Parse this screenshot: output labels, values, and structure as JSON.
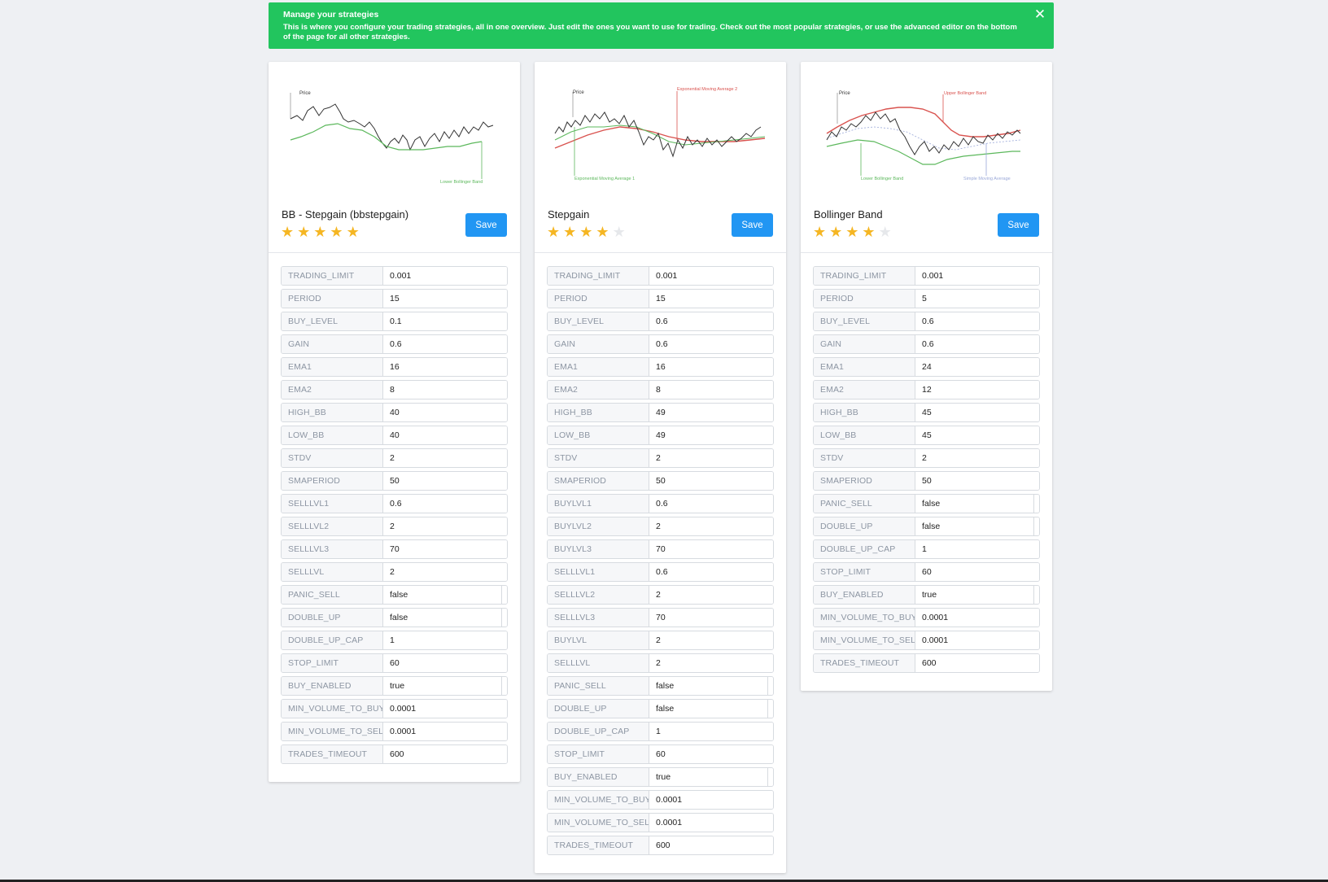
{
  "alert": {
    "title": "Manage your strategies",
    "text": "This is where you configure your trading strategies, all in one overview. Just edit the ones you want to use for trading. Check out the most popular strategies, or use the advanced editor on the bottom of the page for all other strategies.",
    "close_icon": "close-icon",
    "color": "#22c55e"
  },
  "colors": {
    "accent": "#2196f3",
    "toggle_on": "#22c55e",
    "toggle_off": "#f44336",
    "star": "#f5b623"
  },
  "cards": [
    {
      "title": "BB - Stepgain (bbstepgain)",
      "rating": 5,
      "save_label": "Save",
      "chart": {
        "price_label": "Price",
        "annotations": [
          "Lower Bollinger Band"
        ]
      },
      "params": [
        {
          "key": "TRADING_LIMIT",
          "value": "0.001"
        },
        {
          "key": "PERIOD",
          "value": "15"
        },
        {
          "key": "BUY_LEVEL",
          "value": "0.1"
        },
        {
          "key": "GAIN",
          "value": "0.6"
        },
        {
          "key": "EMA1",
          "value": "16"
        },
        {
          "key": "EMA2",
          "value": "8"
        },
        {
          "key": "HIGH_BB",
          "value": "40"
        },
        {
          "key": "LOW_BB",
          "value": "40"
        },
        {
          "key": "STDV",
          "value": "2"
        },
        {
          "key": "SMAPERIOD",
          "value": "50"
        },
        {
          "key": "SELLLVL1",
          "value": "0.6"
        },
        {
          "key": "SELLLVL2",
          "value": "2"
        },
        {
          "key": "SELLLVL3",
          "value": "70"
        },
        {
          "key": "SELLLVL",
          "value": "2"
        },
        {
          "key": "PANIC_SELL",
          "value": "false",
          "toggle": "OFF"
        },
        {
          "key": "DOUBLE_UP",
          "value": "false",
          "toggle": "OFF"
        },
        {
          "key": "DOUBLE_UP_CAP",
          "value": "1"
        },
        {
          "key": "STOP_LIMIT",
          "value": "60"
        },
        {
          "key": "BUY_ENABLED",
          "value": "true",
          "toggle": "ON"
        },
        {
          "key": "MIN_VOLUME_TO_BUY",
          "value": "0.0001"
        },
        {
          "key": "MIN_VOLUME_TO_SELL",
          "value": "0.0001"
        },
        {
          "key": "TRADES_TIMEOUT",
          "value": "600"
        }
      ]
    },
    {
      "title": "Stepgain",
      "rating": 4,
      "save_label": "Save",
      "chart": {
        "price_label": "Price",
        "annotations": [
          "Exponential Moving Average 2",
          "Exponential Moving Average 1"
        ]
      },
      "params": [
        {
          "key": "TRADING_LIMIT",
          "value": "0.001"
        },
        {
          "key": "PERIOD",
          "value": "15"
        },
        {
          "key": "BUY_LEVEL",
          "value": "0.6"
        },
        {
          "key": "GAIN",
          "value": "0.6"
        },
        {
          "key": "EMA1",
          "value": "16"
        },
        {
          "key": "EMA2",
          "value": "8"
        },
        {
          "key": "HIGH_BB",
          "value": "49"
        },
        {
          "key": "LOW_BB",
          "value": "49"
        },
        {
          "key": "STDV",
          "value": "2"
        },
        {
          "key": "SMAPERIOD",
          "value": "50"
        },
        {
          "key": "BUYLVL1",
          "value": "0.6"
        },
        {
          "key": "BUYLVL2",
          "value": "2"
        },
        {
          "key": "BUYLVL3",
          "value": "70"
        },
        {
          "key": "SELLLVL1",
          "value": "0.6"
        },
        {
          "key": "SELLLVL2",
          "value": "2"
        },
        {
          "key": "SELLLVL3",
          "value": "70"
        },
        {
          "key": "BUYLVL",
          "value": "2"
        },
        {
          "key": "SELLLVL",
          "value": "2"
        },
        {
          "key": "PANIC_SELL",
          "value": "false",
          "toggle": "OFF"
        },
        {
          "key": "DOUBLE_UP",
          "value": "false",
          "toggle": "OFF"
        },
        {
          "key": "DOUBLE_UP_CAP",
          "value": "1"
        },
        {
          "key": "STOP_LIMIT",
          "value": "60"
        },
        {
          "key": "BUY_ENABLED",
          "value": "true",
          "toggle": "ON"
        },
        {
          "key": "MIN_VOLUME_TO_BUY",
          "value": "0.0001"
        },
        {
          "key": "MIN_VOLUME_TO_SELL",
          "value": "0.0001"
        },
        {
          "key": "TRADES_TIMEOUT",
          "value": "600"
        }
      ]
    },
    {
      "title": "Bollinger Band",
      "rating": 4,
      "save_label": "Save",
      "chart": {
        "price_label": "Price",
        "annotations": [
          "Upper Bollinger Band",
          "Lower Bollinger Band",
          "Simple Moving Average"
        ]
      },
      "params": [
        {
          "key": "TRADING_LIMIT",
          "value": "0.001"
        },
        {
          "key": "PERIOD",
          "value": "5"
        },
        {
          "key": "BUY_LEVEL",
          "value": "0.6"
        },
        {
          "key": "GAIN",
          "value": "0.6"
        },
        {
          "key": "EMA1",
          "value": "24"
        },
        {
          "key": "EMA2",
          "value": "12"
        },
        {
          "key": "HIGH_BB",
          "value": "45"
        },
        {
          "key": "LOW_BB",
          "value": "45"
        },
        {
          "key": "STDV",
          "value": "2"
        },
        {
          "key": "SMAPERIOD",
          "value": "50"
        },
        {
          "key": "PANIC_SELL",
          "value": "false",
          "toggle": "OFF"
        },
        {
          "key": "DOUBLE_UP",
          "value": "false",
          "toggle": "OFF"
        },
        {
          "key": "DOUBLE_UP_CAP",
          "value": "1"
        },
        {
          "key": "STOP_LIMIT",
          "value": "60"
        },
        {
          "key": "BUY_ENABLED",
          "value": "true",
          "toggle": "ON"
        },
        {
          "key": "MIN_VOLUME_TO_BUY",
          "value": "0.0001"
        },
        {
          "key": "MIN_VOLUME_TO_SELL",
          "value": "0.0001"
        },
        {
          "key": "TRADES_TIMEOUT",
          "value": "600"
        }
      ]
    }
  ]
}
